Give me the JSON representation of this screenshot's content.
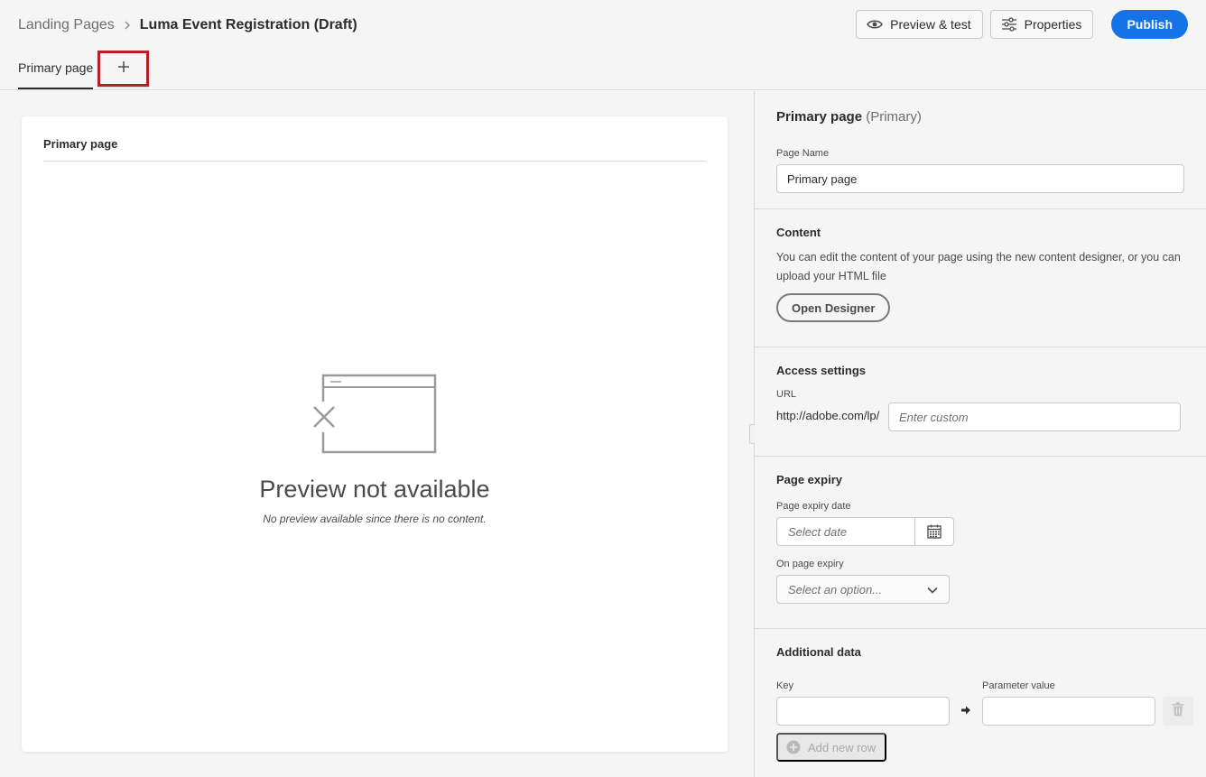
{
  "breadcrumb": {
    "parent": "Landing Pages",
    "current": "Luma Event Registration (Draft)"
  },
  "header_actions": {
    "preview_label": "Preview & test",
    "properties_label": "Properties",
    "publish_label": "Publish"
  },
  "tabs": {
    "items": [
      {
        "label": "Primary page",
        "selected": true
      }
    ],
    "add_icon": "plus-icon"
  },
  "preview": {
    "card_title": "Primary page",
    "empty_title": "Preview not available",
    "empty_subtitle": "No preview available since there is no content.",
    "icon": "broken-window-icon"
  },
  "properties": {
    "heading": "Primary page",
    "heading_tag": "(Primary)",
    "page_name_label": "Page Name",
    "page_name_value": "Primary page"
  },
  "content_section": {
    "title": "Content",
    "description": "You can edit the content of your page using the new content designer, or you can upload your HTML file",
    "designer_button": "Open Designer"
  },
  "access_settings": {
    "title": "Access settings",
    "url_label": "URL",
    "url_prefix": "http://adobe.com/lp/",
    "url_placeholder": "Enter custom"
  },
  "page_expiry": {
    "title": "Page expiry",
    "date_label": "Page expiry date",
    "date_placeholder": "Select date",
    "on_expiry_label": "On page expiry",
    "on_expiry_placeholder": "Select an option..."
  },
  "additional_data": {
    "title": "Additional data",
    "key_label": "Key",
    "value_label": "Parameter value",
    "add_row_label": "Add new row"
  },
  "colors": {
    "publish_blue": "#1473e6",
    "highlight_red": "#b42026"
  }
}
